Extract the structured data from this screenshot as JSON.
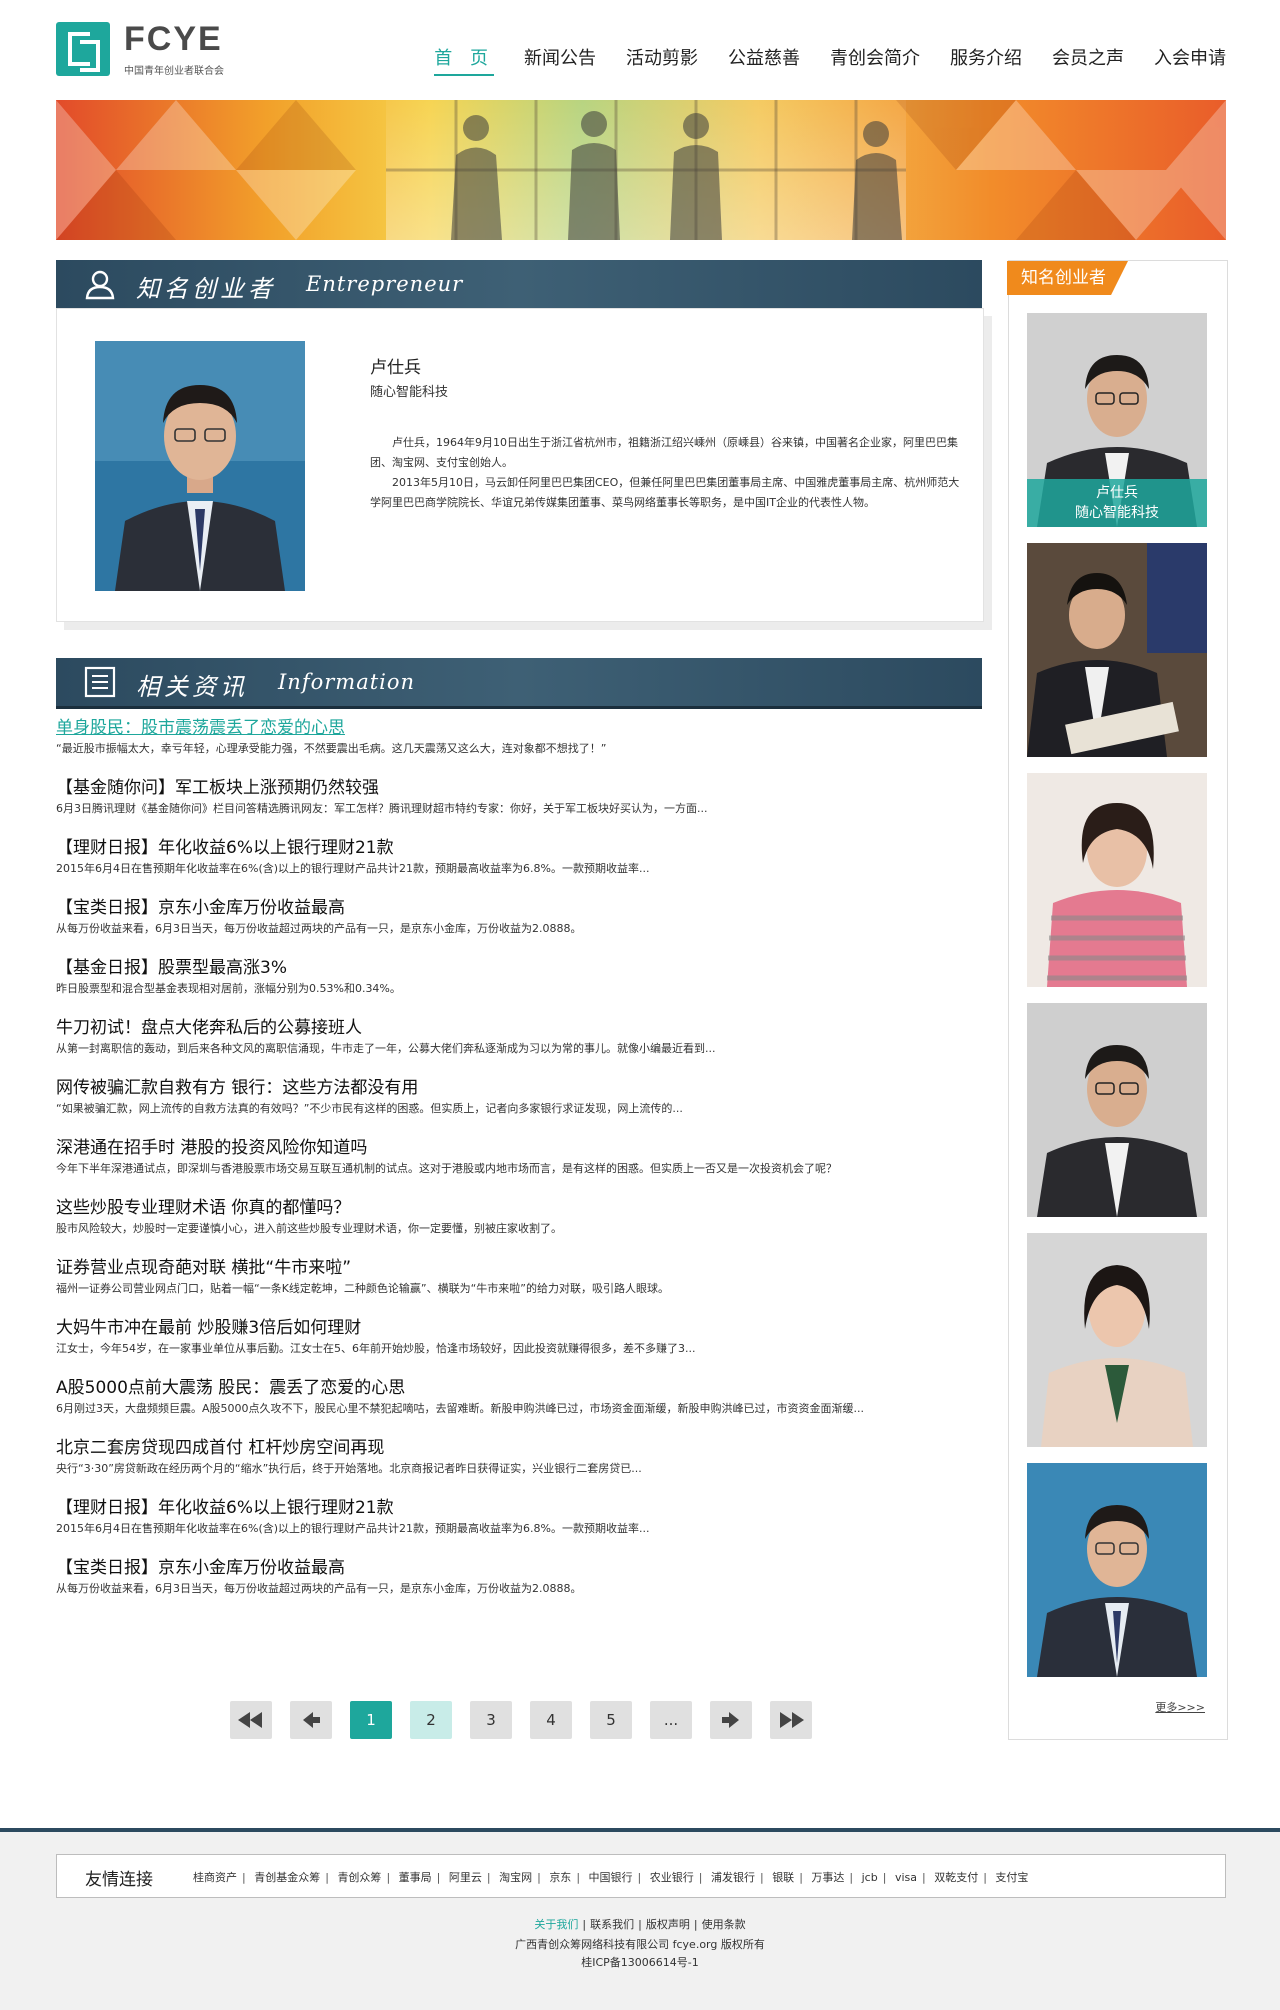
{
  "logo": {
    "text": "FCYE",
    "subtitle": "中国青年创业者联合会"
  },
  "nav": [
    {
      "label": "首 页",
      "active": true
    },
    {
      "label": "新闻公告"
    },
    {
      "label": "活动剪影"
    },
    {
      "label": "公益慈善"
    },
    {
      "label": "青创会简介"
    },
    {
      "label": "服务介绍"
    },
    {
      "label": "会员之声"
    },
    {
      "label": "入会申请"
    }
  ],
  "entrepreneur_section": {
    "title_cn": "知名创业者",
    "title_en": "Entrepreneur",
    "name": "卢仕兵",
    "company": "随心智能科技",
    "bio": [
      "卢仕兵，1964年9月10日出生于浙江省杭州市，祖籍浙江绍兴嵊州（原嵊县）谷来镇，中国著名企业家，阿里巴巴集团、淘宝网、支付宝创始人。",
      "2013年5月10日，马云卸任阿里巴巴集团CEO，但兼任阿里巴巴集团董事局主席、中国雅虎董事局主席、杭州师范大学阿里巴巴商学院院长、华谊兄弟传媒集团董事、菜鸟网络董事长等职务，是中国IT企业的代表性人物。"
    ]
  },
  "info_section": {
    "title_cn": "相关资讯",
    "title_en": "Information",
    "items": [
      {
        "title": "单身股民：股市震荡震丢了恋爱的心思",
        "desc": "“最近股市振幅太大，幸亏年轻，心理承受能力强，不然要震出毛病。这几天震荡又这么大，连对象都不想找了！”"
      },
      {
        "title": "【基金随你问】军工板块上涨预期仍然较强",
        "desc": "6月3日腾讯理财《基金随你问》栏目问答精选腾讯网友：军工怎样？腾讯理财超市特约专家：你好，关于军工板块好买认为，一方面..."
      },
      {
        "title": "【理财日报】年化收益6%以上银行理财21款",
        "desc": "2015年6月4日在售预期年化收益率在6%(含)以上的银行理财产品共计21款，预期最高收益率为6.8%。一款预期收益率..."
      },
      {
        "title": "【宝类日报】京东小金库万份收益最高",
        "desc": "从每万份收益来看，6月3日当天，每万份收益超过两块的产品有一只，是京东小金库，万份收益为2.0888。"
      },
      {
        "title": "【基金日报】股票型最高涨3%",
        "desc": "昨日股票型和混合型基金表现相对居前，涨幅分别为0.53%和0.34%。"
      },
      {
        "title": "牛刀初试！盘点大佬奔私后的公募接班人",
        "desc": "从第一封离职信的轰动，到后来各种文风的离职信涌现，牛市走了一年，公募大佬们奔私逐渐成为习以为常的事儿。就像小编最近看到..."
      },
      {
        "title": "网传被骗汇款自救有方 银行：这些方法都没有用",
        "desc": "“如果被骗汇款，网上流传的自救方法真的有效吗？”不少市民有这样的困惑。但实质上，记者向多家银行求证发现，网上流传的..."
      },
      {
        "title": "深港通在招手时 港股的投资风险你知道吗",
        "desc": "今年下半年深港通试点，即深圳与香港股票市场交易互联互通机制的试点。这对于港股或内地市场而言，是有这样的困惑。但实质上一否又是一次投资机会了呢？"
      },
      {
        "title": "这些炒股专业理财术语 你真的都懂吗？",
        "desc": "股市风险较大，炒股时一定要谨慎小心，进入前这些炒股专业理财术语，你一定要懂，别被庄家收割了。"
      },
      {
        "title": "证券营业点现奇葩对联 横批“牛市来啦”",
        "desc": "福州一证券公司营业网点门口，贴着一幅“一条K线定乾坤，二种颜色论输赢”、横联为“牛市来啦”的给力对联，吸引路人眼球。"
      },
      {
        "title": "大妈牛市冲在最前 炒股赚3倍后如何理财",
        "desc": "江女士，今年54岁，在一家事业单位从事后勤。江女士在5、6年前开始炒股，恰逢市场较好，因此投资就赚得很多，差不多赚了3..."
      },
      {
        "title": "A股5000点前大震荡 股民：震丢了恋爱的心思",
        "desc": "6月刚过3天，大盘频频巨震。A股5000点久攻不下，股民心里不禁犯起嘀咕，去留难断。新股申购洪峰已过，市场资金面渐缓，新股申购洪峰已过，市资资金面渐缓..."
      },
      {
        "title": "北京二套房贷现四成首付 杠杆炒房空间再现",
        "desc": "央行“3·30”房贷新政在经历两个月的“缩水”执行后，终于开始落地。北京商报记者昨日获得证实，兴业银行二套房贷已..."
      },
      {
        "title": "【理财日报】年化收益6%以上银行理财21款",
        "desc": "2015年6月4日在售预期年化收益率在6%(含)以上的银行理财产品共计21款，预期最高收益率为6.8%。一款预期收益率..."
      },
      {
        "title": "【宝类日报】京东小金库万份收益最高",
        "desc": "从每万份收益来看，6月3日当天，每万份收益超过两块的产品有一只，是京东小金库，万份收益为2.0888。"
      }
    ]
  },
  "pagination": {
    "pages": [
      "1",
      "2",
      "3",
      "4",
      "5",
      "..."
    ],
    "current": "1"
  },
  "sidebar": {
    "title": "知名创业者",
    "featured": {
      "name": "卢仕兵",
      "company": "随心智能科技"
    },
    "more_label": "更多>>>"
  },
  "footer": {
    "links_title": "友情连接",
    "links": [
      "桂商资产",
      "青创基金众筹",
      "青创众筹",
      "董事局",
      "阿里云",
      "淘宝网",
      "京东",
      "中国银行",
      "农业银行",
      "浦发银行",
      "银联",
      "万事达",
      "jcb",
      "visa",
      "双乾支付",
      "支付宝"
    ],
    "nav": [
      "关于我们",
      "联系我们",
      "版权声明",
      "使用条款"
    ],
    "copyright": "广西青创众筹网络科技有限公司 fcye.org 版权所有",
    "icp": "桂ICP备13006614号-1"
  },
  "colors": {
    "accent": "#1ea79c",
    "tag": "#f08a1c",
    "bar": "#2c4a5f"
  }
}
